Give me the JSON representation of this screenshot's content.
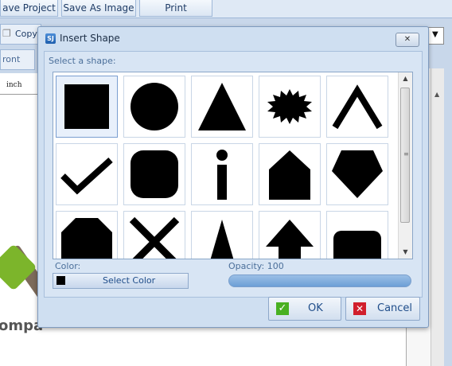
{
  "toolbar": {
    "save_project": "ave Project",
    "save_as_image": "Save As Image",
    "print": "Print",
    "copy": "Copy",
    "front": "ront",
    "ruler_unit": "inch"
  },
  "canvas": {
    "logo_text": "ompa"
  },
  "dialog": {
    "title": "Insert Shape",
    "icon_text": "SJ",
    "close_symbol": "✕",
    "select_label": "Select a shape:",
    "color_label": "Color:",
    "select_color_label": "Select Color",
    "opacity_label": "Opacity:",
    "opacity_value": "100",
    "ok_label": "OK",
    "cancel_label": "Cancel",
    "shapes": [
      "square",
      "circle",
      "triangle",
      "starburst",
      "chevron-up",
      "checkmark",
      "rounded-square",
      "info-i",
      "house-pentagon",
      "pentagon-down",
      "octagon-partial",
      "cross",
      "triangle-narrow",
      "arrow-up",
      "rounded-rect"
    ]
  },
  "colors": {
    "accent": "#1f4d8a",
    "selected_color": "#000000"
  }
}
